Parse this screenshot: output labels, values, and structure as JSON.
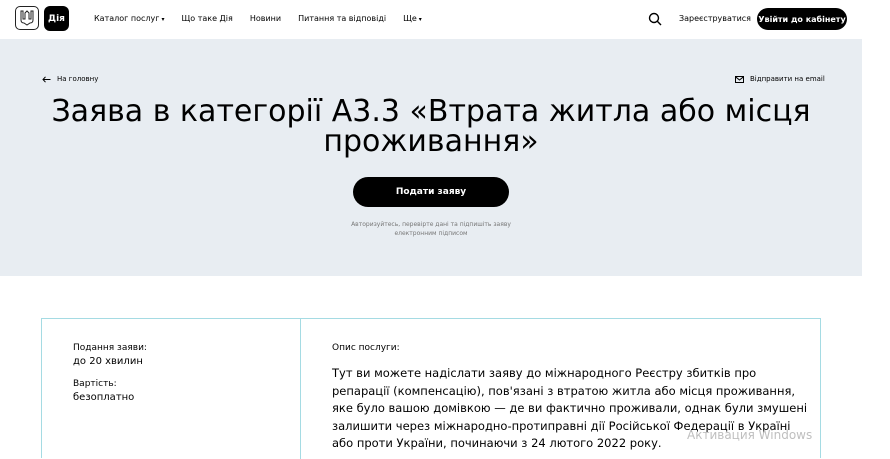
{
  "header": {
    "logo_label": "Дія",
    "nav": [
      {
        "label": "Каталог послуг",
        "has_caret": true
      },
      {
        "label": "Що таке Дія",
        "has_caret": false
      },
      {
        "label": "Новини",
        "has_caret": false
      },
      {
        "label": "Питання та відповіді",
        "has_caret": false
      },
      {
        "label": "Ще",
        "has_caret": true
      }
    ],
    "search_icon": "search-icon",
    "register_label": "Зареєструватися",
    "login_label": "Увійти до кабінету"
  },
  "hero": {
    "back_label": "На головну",
    "email_label": "Відправити на email",
    "title": "Заява в категорії А3.3 «Втрата житла або місця проживання»",
    "apply_label": "Подати заяву",
    "apply_hint": "Авторизуйтесь, перевірте дані та підпишіть заяву електронним підписом"
  },
  "details": {
    "submit_time_label": "Подання заяви:",
    "submit_time_value": "до 20 хвилин",
    "cost_label": "Вартість:",
    "cost_value": "безоплатно",
    "description_label": "Опис послуги:",
    "description": "Тут ви можете надіслати заяву до міжнародного Реєстру збитків про репарації (компенсацію), пов'язані з втратою житла або місця проживання, яке було вашою домівкою — де ви фактично проживали, однак були змушені залишити через міжнародно-протиправні дії Російської Федерації в Україні або проти України, починаючи з 24 лютого 2022 року."
  },
  "system": {
    "activation_text": "Активация Windows"
  },
  "colors": {
    "hero_bg": "#e8edf2",
    "card_border": "#a5dbe3",
    "button_bg": "#000000"
  }
}
